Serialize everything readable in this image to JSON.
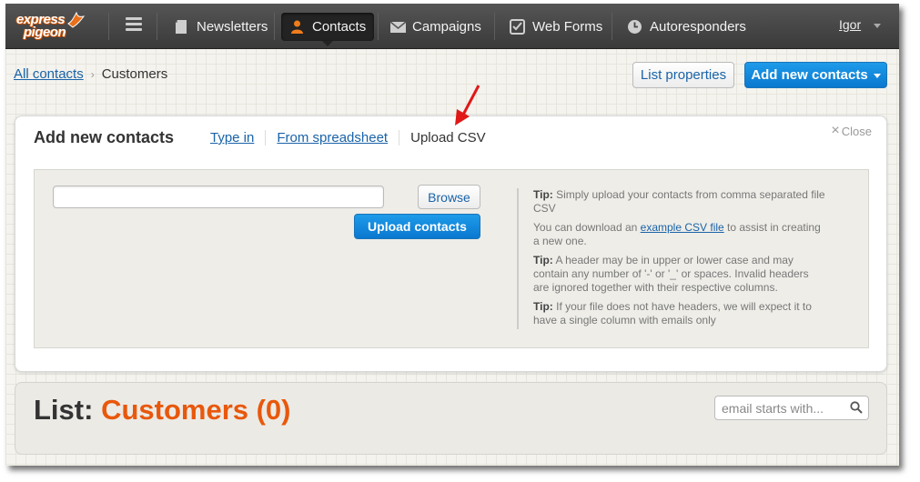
{
  "brand": {
    "logo_line1": "express",
    "logo_line2": "pigeon",
    "accent": "#e8580c",
    "link": "#1a63a8",
    "primary": "#0a78cf"
  },
  "nav": {
    "items": [
      {
        "label": "Newsletters",
        "icon": "newsletter-icon"
      },
      {
        "label": "Contacts",
        "icon": "person-icon",
        "active": true
      },
      {
        "label": "Campaigns",
        "icon": "envelope-icon"
      },
      {
        "label": "Web Forms",
        "icon": "checkbox-icon"
      },
      {
        "label": "Autoresponders",
        "icon": "clock-icon"
      }
    ],
    "user": "Igor"
  },
  "breadcrumb": {
    "root": "All contacts",
    "current": "Customers"
  },
  "toolbar": {
    "list_properties": "List properties",
    "add_new_contacts": "Add new contacts"
  },
  "add_panel": {
    "title": "Add new contacts",
    "tabs": [
      "Type in",
      "From spreadsheet",
      "Upload CSV"
    ],
    "close": "Close",
    "browse": "Browse",
    "upload": "Upload contacts",
    "file_value": "",
    "tips": {
      "t1_label": "Tip:",
      "t1_text": " Simply upload your contacts from comma separated file CSV",
      "t2_pre": "You can download an ",
      "t2_link": "example CSV file",
      "t2_post": " to assist in creating a new one.",
      "t3_label": "Tip:",
      "t3_text": " A header may be in upper or lower case and may contain any number of '-' or '_' or spaces. Invalid headers are ignored together with their respective columns.",
      "t4_label": "Tip:",
      "t4_text": " If your file does not have headers, we will expect it to have a single column with emails only"
    }
  },
  "list": {
    "prefix": "List:",
    "name": "Customers (0)",
    "search_placeholder": "email starts with..."
  }
}
